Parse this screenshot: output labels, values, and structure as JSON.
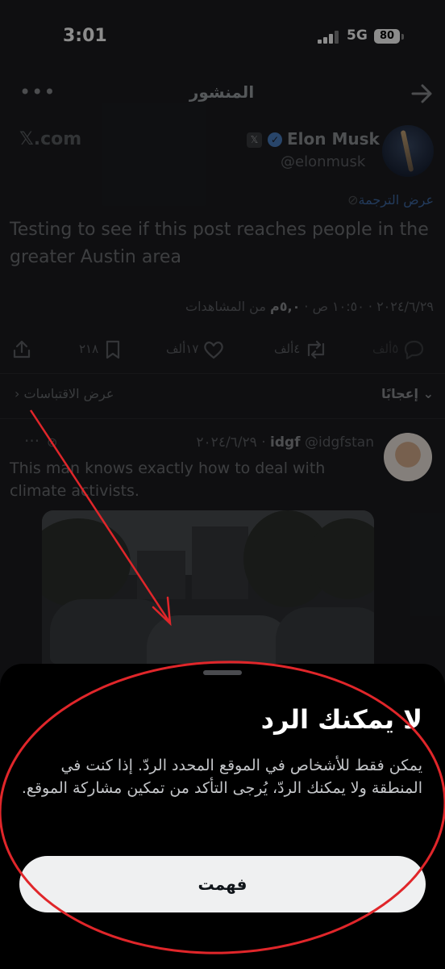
{
  "status_bar": {
    "time": "3:01",
    "network": "5G",
    "battery": "80"
  },
  "header": {
    "title": "المنشور",
    "more_glyph": "•••"
  },
  "post": {
    "site_label": "𝕏.com",
    "author_name": "Elon Musk",
    "author_handle": "@elonmusk",
    "translate_label": "عرض الترجمة",
    "text": "Testing to see if this post reaches people in the greater Austin area",
    "meta_prefix": "٢٠٢٤/٦/٢٩ · ١٠:٥٠ ص · ",
    "views_count": "٥,٠م",
    "views_label": " من المشاهدات",
    "actions": {
      "replies": "٥ألف",
      "reposts": "٤ألف",
      "likes": "١٧ألف",
      "bookmarks": "٢١٨"
    }
  },
  "tabs": {
    "likes": "إعجابًا",
    "quotes": "عرض الاقتباسات"
  },
  "reply": {
    "name": "idgf",
    "handle_date": "@idgfstan · ٢٠٢٤/٦/٢٩",
    "text": "This man knows exactly how to deal with climate activists."
  },
  "sheet": {
    "title": "لا يمكنك الرد",
    "body": "يمكن فقط للأشخاص في الموقع المحدد الردّ. إذا كنت في المنطقة ولا يمكنك الردّ، يُرجى التأكد من تمكين مشاركة الموقع.",
    "button": "فهمت"
  },
  "colors": {
    "annotation": "#e0262a",
    "accent": "#1d9bf0",
    "sheet_bg": "#000000"
  }
}
